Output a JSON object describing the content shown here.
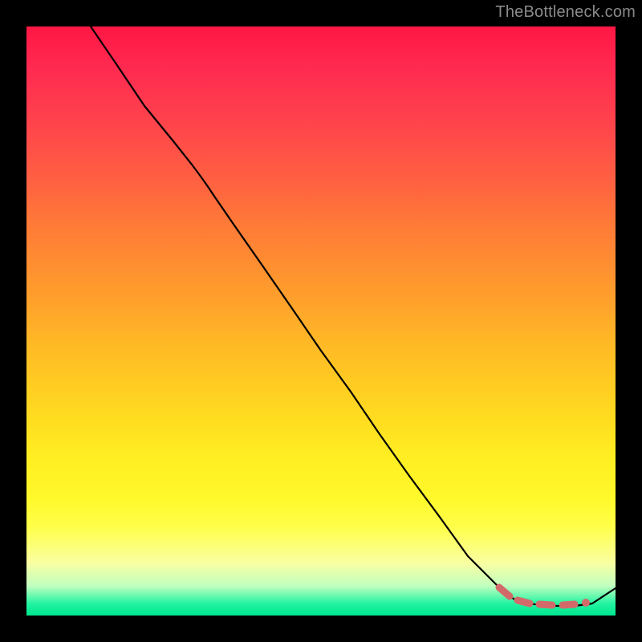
{
  "watermark": "TheBottleneck.com",
  "colors": {
    "background": "#000000",
    "gradient_top": "#ff1744",
    "gradient_bottom": "#00e58f",
    "line": "#000000",
    "highlight": "#d36a6a"
  },
  "chart_data": {
    "type": "line",
    "title": "",
    "xlabel": "",
    "ylabel": "",
    "xlim": [
      0,
      100
    ],
    "ylim": [
      0,
      100
    ],
    "grid": false,
    "legend": false,
    "series": [
      {
        "name": "curve",
        "x": [
          11,
          15,
          20,
          25,
          28,
          30,
          35,
          40,
          45,
          50,
          55,
          60,
          65,
          70,
          75,
          80,
          83,
          85,
          88,
          90,
          93,
          96,
          100
        ],
        "y": [
          100,
          94,
          87,
          81,
          77,
          74,
          67,
          60,
          52,
          45,
          38,
          31,
          24,
          17,
          10,
          5,
          3,
          2.2,
          1.8,
          1.6,
          1.6,
          2,
          4.5
        ]
      }
    ],
    "highlight_region": {
      "description": "dashed plateau near x-axis minimum",
      "x_start": 80,
      "x_end": 96,
      "y_approx": 2,
      "end_dot": {
        "x": 96,
        "y": 2
      }
    }
  }
}
